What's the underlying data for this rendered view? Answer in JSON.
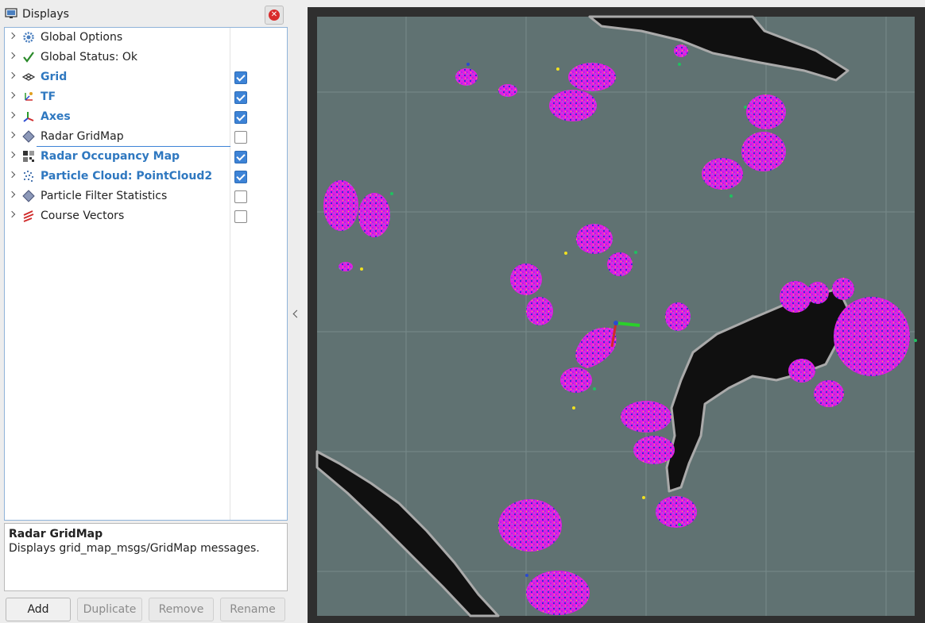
{
  "panel": {
    "title": "Displays",
    "icon": "monitor-icon",
    "close_icon": "close-icon"
  },
  "displays": [
    {
      "label": "Global Options",
      "icon": "gear-icon",
      "checkbox": null,
      "emphasis": false
    },
    {
      "label": "Global Status: Ok",
      "icon": "checkmark-icon",
      "checkbox": null,
      "emphasis": false
    },
    {
      "label": "Grid",
      "icon": "grid-icon",
      "checkbox": true,
      "emphasis": true
    },
    {
      "label": "TF",
      "icon": "tf-icon",
      "checkbox": true,
      "emphasis": true
    },
    {
      "label": "Axes",
      "icon": "axes-icon",
      "checkbox": true,
      "emphasis": true
    },
    {
      "label": "Radar GridMap",
      "icon": "diamond-icon",
      "checkbox": false,
      "emphasis": false,
      "selected": true
    },
    {
      "label": "Radar Occupancy Map",
      "icon": "occupancy-map-icon",
      "checkbox": true,
      "emphasis": true
    },
    {
      "label": "Particle Cloud: PointCloud2",
      "icon": "point-cloud-icon",
      "checkbox": true,
      "emphasis": true
    },
    {
      "label": "Particle Filter Statistics",
      "icon": "diamond-icon",
      "checkbox": false,
      "emphasis": false
    },
    {
      "label": "Course Vectors",
      "icon": "course-vectors-icon",
      "checkbox": false,
      "emphasis": false
    }
  ],
  "description": {
    "title": "Radar GridMap",
    "text": "Displays grid_map_msgs/GridMap messages."
  },
  "buttons": {
    "add": "Add",
    "duplicate": "Duplicate",
    "remove": "Remove",
    "rename": "Rename"
  },
  "colors": {
    "map_free": "#607272",
    "map_obstacle": "#101010",
    "map_outline": "#aaaaaa",
    "map_border": "#2f2f2f",
    "particle_core": "#e020e0",
    "particle_alt": "#3a2ad8",
    "accent": "#3d83d6"
  }
}
